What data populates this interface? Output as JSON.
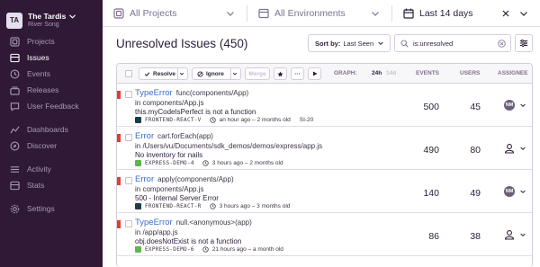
{
  "sidebar": {
    "org_initials": "TA",
    "org_name": "The Tardis",
    "user_name": "River Song",
    "items": [
      {
        "label": "Projects",
        "icon": "projects-icon"
      },
      {
        "label": "Issues",
        "icon": "issues-icon",
        "active": true
      },
      {
        "label": "Events",
        "icon": "events-icon"
      },
      {
        "label": "Releases",
        "icon": "releases-icon"
      },
      {
        "label": "User Feedback",
        "icon": "feedback-icon"
      },
      {
        "label": "Dashboards",
        "icon": "dashboards-icon"
      },
      {
        "label": "Discover",
        "icon": "discover-icon"
      },
      {
        "label": "Activity",
        "icon": "activity-icon"
      },
      {
        "label": "Stats",
        "icon": "stats-icon"
      },
      {
        "label": "Settings",
        "icon": "gear-icon"
      }
    ]
  },
  "topbar": {
    "projects": "All Projects",
    "environments": "All Environments",
    "period": "Last 14 days"
  },
  "header": {
    "title": "Unresolved Issues",
    "count": "(450)",
    "sort_prefix": "Sort by:",
    "sort_value": "Last Seen",
    "search_value": "is:unresolved"
  },
  "table": {
    "resolve": "Resolve",
    "ignore": "Ignore",
    "merge": "Merge",
    "more": "···",
    "graph_label": "GRAPH:",
    "graph_24h": "24h",
    "graph_14d": "14d",
    "events_label": "EVENTS",
    "users_label": "USERS",
    "assignee_label": "ASSIGNEE"
  },
  "colors": {
    "level_error": "#e03e2f",
    "badge_react": "#1d3b4f",
    "badge_express": "#5fb54e",
    "link": "#3b6ecc"
  },
  "issues": [
    {
      "type": "TypeError",
      "func": "func(components/App)",
      "location": "in components/App.js",
      "message": "this.myCodeIsPerfect is not a function",
      "project": "FRONTEND-REACT-V",
      "project_color": "#1d3b4f",
      "time": "an hour ago – 2 months old",
      "extra": "SI-20",
      "events": "500",
      "users": "45",
      "assignee": "NM"
    },
    {
      "type": "Error",
      "func": "cart.forEach(app)",
      "location": "in /Users/vu/Documents/sdk_demos/demos/express/app.js",
      "message": "No inventory for nails",
      "project": "EXPRESS-DEMO-4",
      "project_color": "#5fb54e",
      "time": "3 hours ago – 2 months old",
      "extra": "",
      "events": "490",
      "users": "80",
      "assignee": ""
    },
    {
      "type": "Error",
      "func": "apply(components/App)",
      "location": "in components/App.js",
      "message": "500 - Internal Server Error",
      "project": "FRONTEND-REACT-R",
      "project_color": "#1d3b4f",
      "time": "3 hours ago – 3 months old",
      "extra": "",
      "events": "140",
      "users": "49",
      "assignee": "NM"
    },
    {
      "type": "TypeError",
      "func": "null.<anonymous>(app)",
      "location": "in /app/app.js",
      "message": "obj.doesNotExist is not a function",
      "project": "EXPRESS-DEMO-6",
      "project_color": "#5fb54e",
      "time": "21 hours ago – a month old",
      "extra": "",
      "events": "86",
      "users": "38",
      "assignee": ""
    }
  ]
}
